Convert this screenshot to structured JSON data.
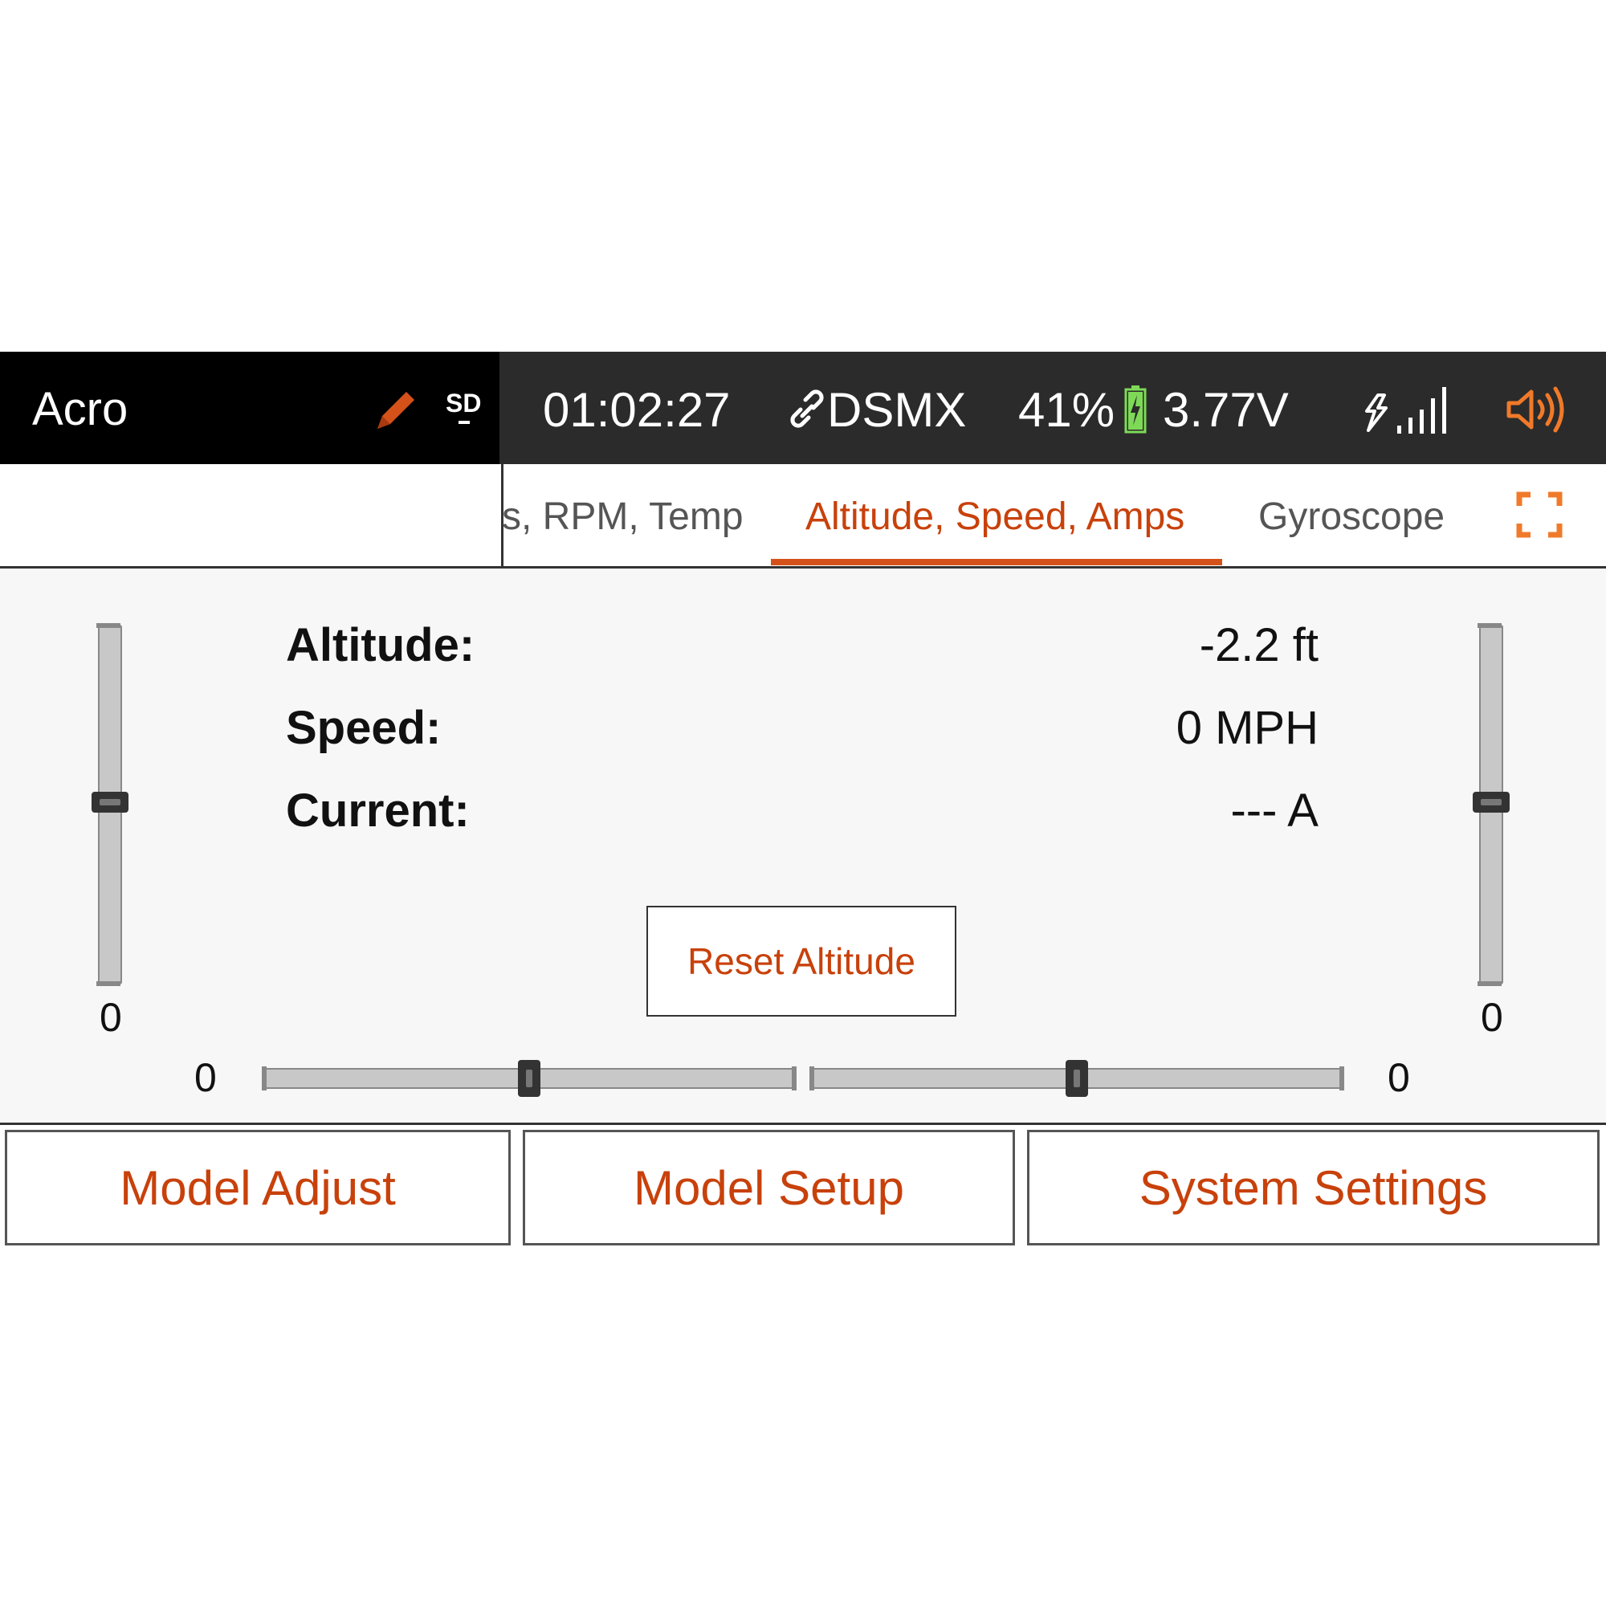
{
  "status_bar": {
    "model_name": "Acro",
    "sd_label": "SD",
    "timer": "01:02:27",
    "protocol": "DSMX",
    "battery_percent": "41%",
    "voltage": "3.77V",
    "icons": [
      "pencil-icon",
      "sd-card-icon",
      "link-icon",
      "battery-charging-icon",
      "telemetry-signal-icon",
      "speaker-icon"
    ]
  },
  "tabs": {
    "items": [
      {
        "label": "s, RPM, Temp",
        "active": false
      },
      {
        "label": "Altitude, Speed, Amps",
        "active": true
      },
      {
        "label": "Gyroscope",
        "active": false
      }
    ],
    "expand_icon": "fullscreen-icon"
  },
  "telemetry": {
    "rows": [
      {
        "label": "Altitude:",
        "value": "-2.2 ft"
      },
      {
        "label": "Speed:",
        "value": "0 MPH"
      },
      {
        "label": "Current:",
        "value": "--- A"
      }
    ],
    "reset_button": "Reset Altitude"
  },
  "trims": {
    "left_vertical": "0",
    "right_vertical": "0",
    "left_horizontal": "0",
    "right_horizontal": "0"
  },
  "bottom_buttons": [
    "Model Adjust",
    "Model Setup",
    "System Settings"
  ],
  "colors": {
    "accent": "#c8410b",
    "status_bar_bg": "#2b2b2b",
    "content_bg": "#f7f7f7",
    "battery_green": "#7ed957"
  }
}
